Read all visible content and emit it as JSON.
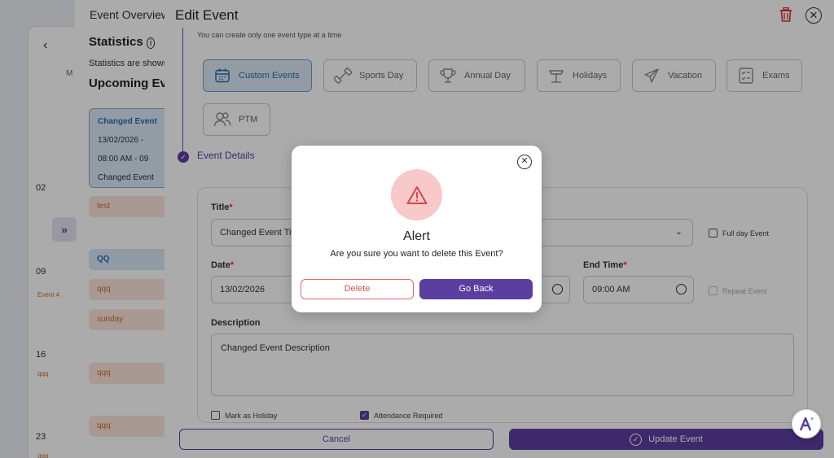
{
  "background": {
    "calendar": {
      "month_label": "M",
      "dates": [
        "02",
        "09",
        "16",
        "23"
      ],
      "tags": [
        "Event 4",
        "qqq",
        "qqq"
      ]
    },
    "overview": {
      "title": "Event Overview",
      "statistics_label": "Statistics",
      "statistics_sub": "Statistics are shown",
      "upcoming_label": "Upcoming Events",
      "card": {
        "title": "Changed Event",
        "date": "13/02/2026 -",
        "time": "08:00 AM - 09",
        "desc": "Changed Event"
      },
      "items": [
        "test",
        "QQ",
        "qqq",
        "sunday",
        "qqq",
        "qqq"
      ]
    }
  },
  "drawer": {
    "title": "Edit Event",
    "hint": "You can create only one event type at a time",
    "event_types": [
      {
        "label": "Custom Events",
        "icon": "calendar-icon",
        "active": true
      },
      {
        "label": "Sports Day",
        "icon": "dumbbell-icon",
        "active": false
      },
      {
        "label": "Annual Day",
        "icon": "trophy-icon",
        "active": false
      },
      {
        "label": "Holidays",
        "icon": "beach-icon",
        "active": false
      },
      {
        "label": "Vacation",
        "icon": "airplane-icon",
        "active": false
      },
      {
        "label": "Exams",
        "icon": "checklist-icon",
        "active": false
      },
      {
        "label": "PTM",
        "icon": "people-icon",
        "active": false
      }
    ],
    "details_label": "Event Details",
    "form": {
      "title_label": "Title",
      "title_value": "Changed Event Tit",
      "full_day_label": "Full day Event",
      "date_label": "Date",
      "date_value": "13/02/2026",
      "end_time_label": "End Time",
      "end_time_value": "09:00 AM",
      "repeat_label": "Repeat Event",
      "description_label": "Description",
      "description_value": "Changed Event Description",
      "mark_holiday_label": "Mark as Holiday",
      "attendance_label": "Attendance Required",
      "required_mark": "*"
    },
    "cancel_label": "Cancel",
    "update_label": "Update Event"
  },
  "alert": {
    "title": "Alert",
    "message": "Are you sure you want to delete this Event?",
    "delete_label": "Delete",
    "back_label": "Go Back"
  },
  "colors": {
    "primary": "#5b3ea0",
    "danger": "#e05050",
    "active_type_bg": "#dbe9f7"
  }
}
